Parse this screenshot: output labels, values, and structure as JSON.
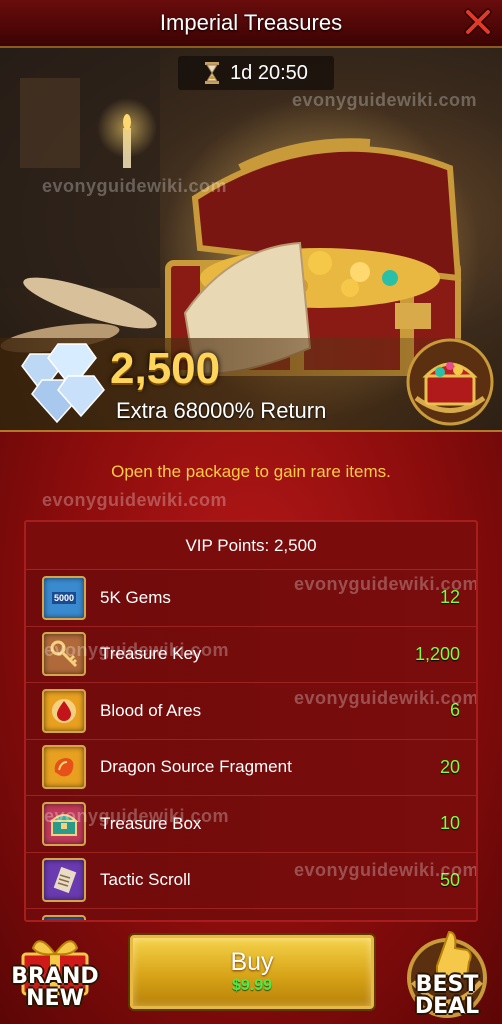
{
  "header": {
    "title": "Imperial Treasures"
  },
  "timer": {
    "value": "1d 20:50"
  },
  "watermark": {
    "text": "evonyguidewiki.com"
  },
  "package": {
    "gem_amount": "2,500",
    "extra_return": "Extra 68000% Return",
    "description": "Open the package to gain rare items.",
    "vip_points": "VIP Points: 2,500"
  },
  "items": [
    {
      "name": "5K Gems",
      "qty": "12",
      "icon": "gem-chest-icon",
      "icon_text": "5000",
      "color": "#3a8ad0"
    },
    {
      "name": "Treasure Key",
      "qty": "1,200",
      "icon": "key-icon",
      "color": "#c07a3a"
    },
    {
      "name": "Blood of Ares",
      "qty": "6",
      "icon": "blood-drop-icon",
      "color": "#c23a1a"
    },
    {
      "name": "Dragon Source Fragment",
      "qty": "20",
      "icon": "dragon-fragment-icon",
      "color": "#e07a20"
    },
    {
      "name": "Treasure Box",
      "qty": "10",
      "icon": "treasure-box-icon",
      "color": "#b02a4a"
    },
    {
      "name": "Tactic Scroll",
      "qty": "50",
      "icon": "scroll-icon",
      "color": "#6a3ab0"
    },
    {
      "name": "",
      "qty": "",
      "icon": "item-icon",
      "color": "#2a5ab0"
    }
  ],
  "footer": {
    "buy_label": "Buy",
    "price": "$9.99",
    "left_badge": [
      "BRAND",
      "NEW"
    ],
    "right_badge": [
      "BEST",
      "DEAL"
    ]
  },
  "colors": {
    "accent_gold": "#ffd45a",
    "quantity_green": "#7fff3a",
    "description_yellow": "#ffcc44",
    "body_red": "#8a0c0c"
  }
}
